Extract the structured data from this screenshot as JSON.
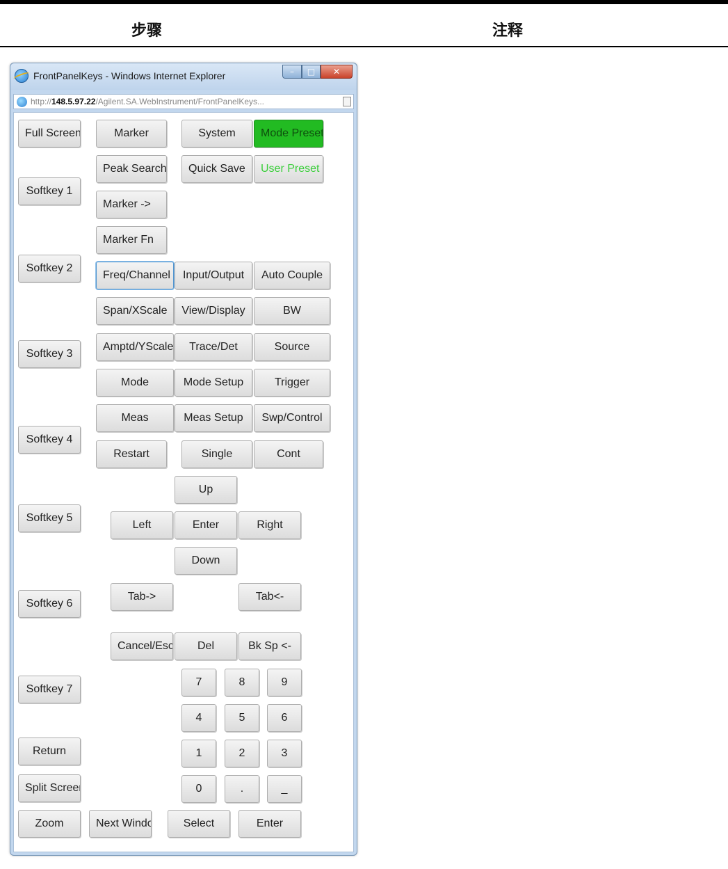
{
  "document": {
    "col_step": "步骤",
    "col_note": "注释"
  },
  "window": {
    "title": "FrontPanelKeys - Windows Internet Explorer",
    "address_prefix": "http://",
    "address_host": "148.5.97.22",
    "address_rest": "/Agilent.SA.WebInstrument/FrontPanelKeys..."
  },
  "softkeys": {
    "full_screen": "Full Screen",
    "softkey_1": "Softkey 1",
    "softkey_2": "Softkey 2",
    "softkey_3": "Softkey 3",
    "softkey_4": "Softkey 4",
    "softkey_5": "Softkey 5",
    "softkey_6": "Softkey 6",
    "softkey_7": "Softkey 7",
    "return": "Return",
    "split_screen": "Split Screen",
    "zoom": "Zoom"
  },
  "keys": {
    "marker": "Marker",
    "system": "System",
    "mode_preset": "Mode Preset",
    "peak_search": "Peak Search",
    "quick_save": "Quick Save",
    "user_preset": "User Preset",
    "marker_to": "Marker ->",
    "marker_fn": "Marker Fn",
    "freq_channel": "Freq/Channel",
    "input_output": "Input/Output",
    "auto_couple": "Auto Couple",
    "span_xscale": "Span/XScale",
    "view_display": "View/Display",
    "bw": "BW",
    "amptd_yscale": "Amptd/YScale",
    "trace_det": "Trace/Det",
    "source": "Source",
    "mode": "Mode",
    "mode_setup": "Mode Setup",
    "trigger": "Trigger",
    "meas": "Meas",
    "meas_setup": "Meas Setup",
    "swp_control": "Swp/Control",
    "restart": "Restart",
    "single": "Single",
    "cont": "Cont",
    "up": "Up",
    "left": "Left",
    "enter_nav": "Enter",
    "right": "Right",
    "down": "Down",
    "tab_fwd": "Tab->",
    "tab_back": "Tab<-",
    "cancel_esc": "Cancel/Esc",
    "del": "Del",
    "bk_sp": "Bk Sp <-",
    "n7": "7",
    "n8": "8",
    "n9": "9",
    "n4": "4",
    "n5": "5",
    "n6": "6",
    "n1": "1",
    "n2": "2",
    "n3": "3",
    "n0": "0",
    "dot": ".",
    "minus": "_",
    "next_window": "Next Window",
    "select": "Select",
    "enter": "Enter"
  }
}
